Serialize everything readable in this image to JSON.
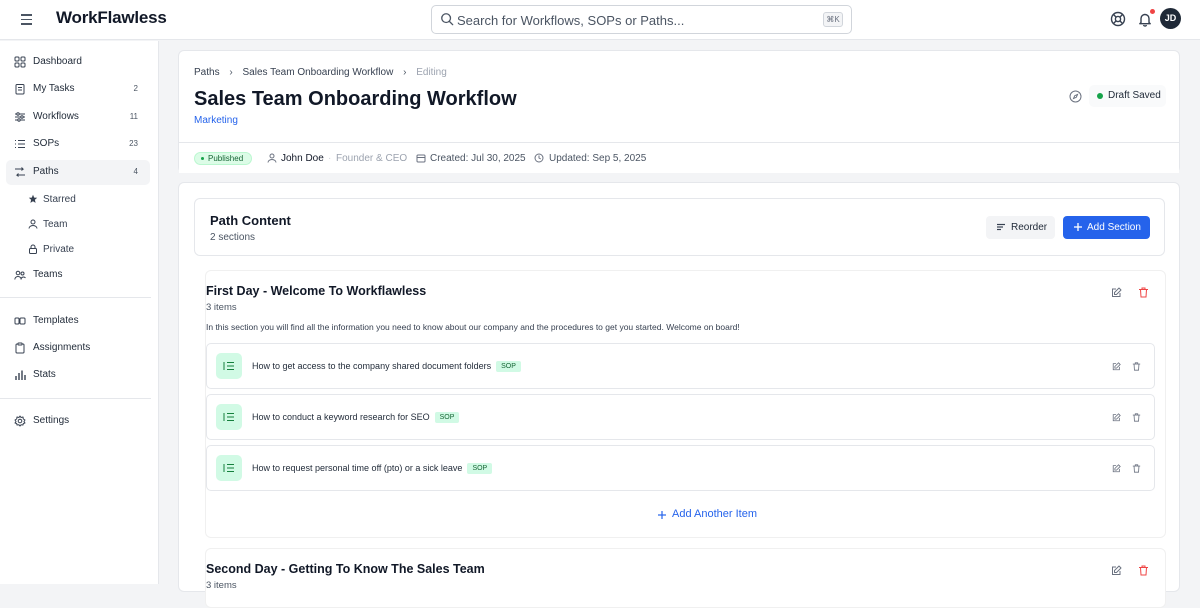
{
  "app": {
    "logo": "WorkFlawless"
  },
  "search": {
    "placeholder": "Search for Workflows, SOPs or Paths...",
    "shortcut": "⌘K"
  },
  "user": {
    "initials": "JD"
  },
  "sidebar": {
    "items": [
      {
        "label": "Dashboard",
        "count": ""
      },
      {
        "label": "My Tasks",
        "count": "2"
      },
      {
        "label": "Workflows",
        "count": "11"
      },
      {
        "label": "SOPs",
        "count": "23"
      },
      {
        "label": "Paths",
        "count": "4"
      }
    ],
    "sub": [
      {
        "label": "Starred"
      },
      {
        "label": "Team"
      },
      {
        "label": "Private"
      }
    ],
    "teams": "Teams",
    "templates": "Templates",
    "assignments": "Assignments",
    "stats": "Stats",
    "settings": "Settings"
  },
  "breadcrumb": {
    "root": "Paths",
    "parent": "Sales Team Onboarding Workflow",
    "current": "Editing"
  },
  "page": {
    "title": "Sales Team Onboarding Workflow",
    "category": "Marketing",
    "draft_status": "Draft Saved"
  },
  "meta": {
    "status": "Published",
    "author": "John Doe",
    "role": "Founder & CEO",
    "created": "Created: Jul 30, 2025",
    "updated": "Updated: Sep 5, 2025"
  },
  "path_content": {
    "title": "Path Content",
    "subtitle": "2 sections",
    "reorder_label": "Reorder",
    "add_section_label": "Add Section"
  },
  "sections": [
    {
      "title": "First Day - Welcome To Workflawless",
      "count": "3 items",
      "description": "In this section you will find all the information you need to know about our company and the procedures to get you started. Welcome on board!",
      "items": [
        {
          "title": "How to get access to the company shared document folders",
          "tag": "SOP"
        },
        {
          "title": "How to conduct a keyword research for SEO",
          "tag": "SOP"
        },
        {
          "title": "How to request personal time off (pto) or a sick leave",
          "tag": "SOP"
        }
      ],
      "add_item_label": "Add Another Item"
    },
    {
      "title": "Second Day - Getting To Know The Sales Team",
      "count": "3 items"
    }
  ],
  "colors": {
    "accent": "#2563eb",
    "success": "#16a34a",
    "danger": "#ef4444"
  }
}
